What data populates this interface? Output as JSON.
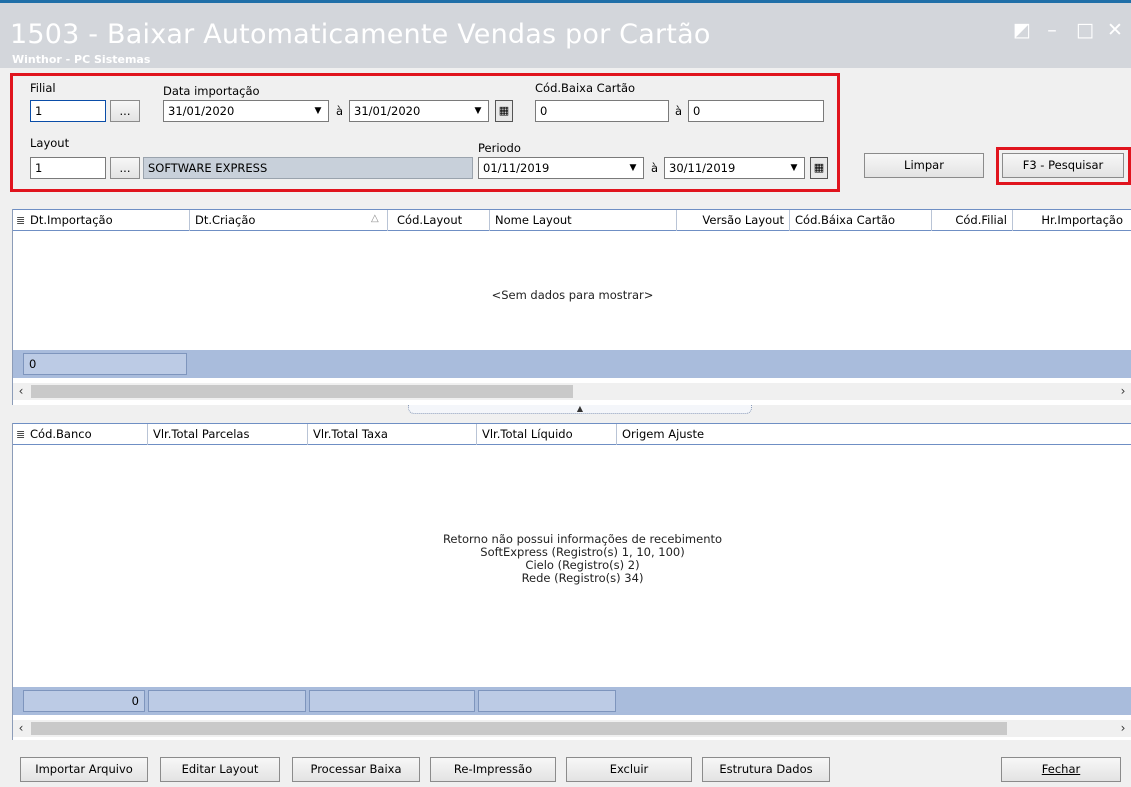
{
  "window": {
    "title": "1503 - Baixar Automaticamente Vendas por Cartão",
    "subtitle": "Winthor - PC Sistemas",
    "controls": [
      "◩",
      "–",
      "□",
      "✕"
    ]
  },
  "filters": {
    "filial_label": "Filial",
    "filial_value": "1",
    "ellipsis": "...",
    "data_importacao_label": "Data importação",
    "data_importacao_from": "31/01/2020",
    "range_sep": "à",
    "data_importacao_to": "31/01/2020",
    "cod_baixa_label": "Cód.Baixa Cartão",
    "cod_baixa_from": "0",
    "cod_baixa_to": "0",
    "layout_label": "Layout",
    "layout_value": "1",
    "layout_name": "SOFTWARE EXPRESS",
    "periodo_label": "Periodo",
    "periodo_from": "01/11/2019",
    "periodo_to": "30/11/2019"
  },
  "actions": {
    "limpar": "Limpar",
    "pesquisar": "F3 - Pesquisar"
  },
  "top_grid": {
    "columns": [
      "Dt.Importação",
      "Dt.Criação",
      "Cód.Layout",
      "Nome Layout",
      "Versão Layout",
      "Cód.Báixa Cartão",
      "Cód.Filial",
      "Hr.Importação"
    ],
    "sort_indicator": "△",
    "empty_message": "<Sem dados para mostrar>",
    "footer_count": "0"
  },
  "bottom_grid": {
    "columns": [
      "Cód.Banco",
      "Vlr.Total Parcelas",
      "Vlr.Total Taxa",
      "Vlr.Total Líquido",
      "Origem Ajuste"
    ],
    "empty_lines": [
      "Retorno não possui informações de recebimento",
      "SoftExpress (Registro(s) 1, 10, 100)",
      "Cielo (Registro(s) 2)",
      "Rede (Registro(s) 34)"
    ],
    "footer_count": "0"
  },
  "bottom_buttons": [
    "Importar Arquivo",
    "Editar Layout",
    "Processar Baixa",
    "Re-Impressão",
    "Excluir",
    "Estrutura Dados",
    "Fechar"
  ],
  "colors": {
    "highlight_border": "#e0141e",
    "grid_footer": "#a9bcdc",
    "titlebar": "#d3d6db"
  }
}
